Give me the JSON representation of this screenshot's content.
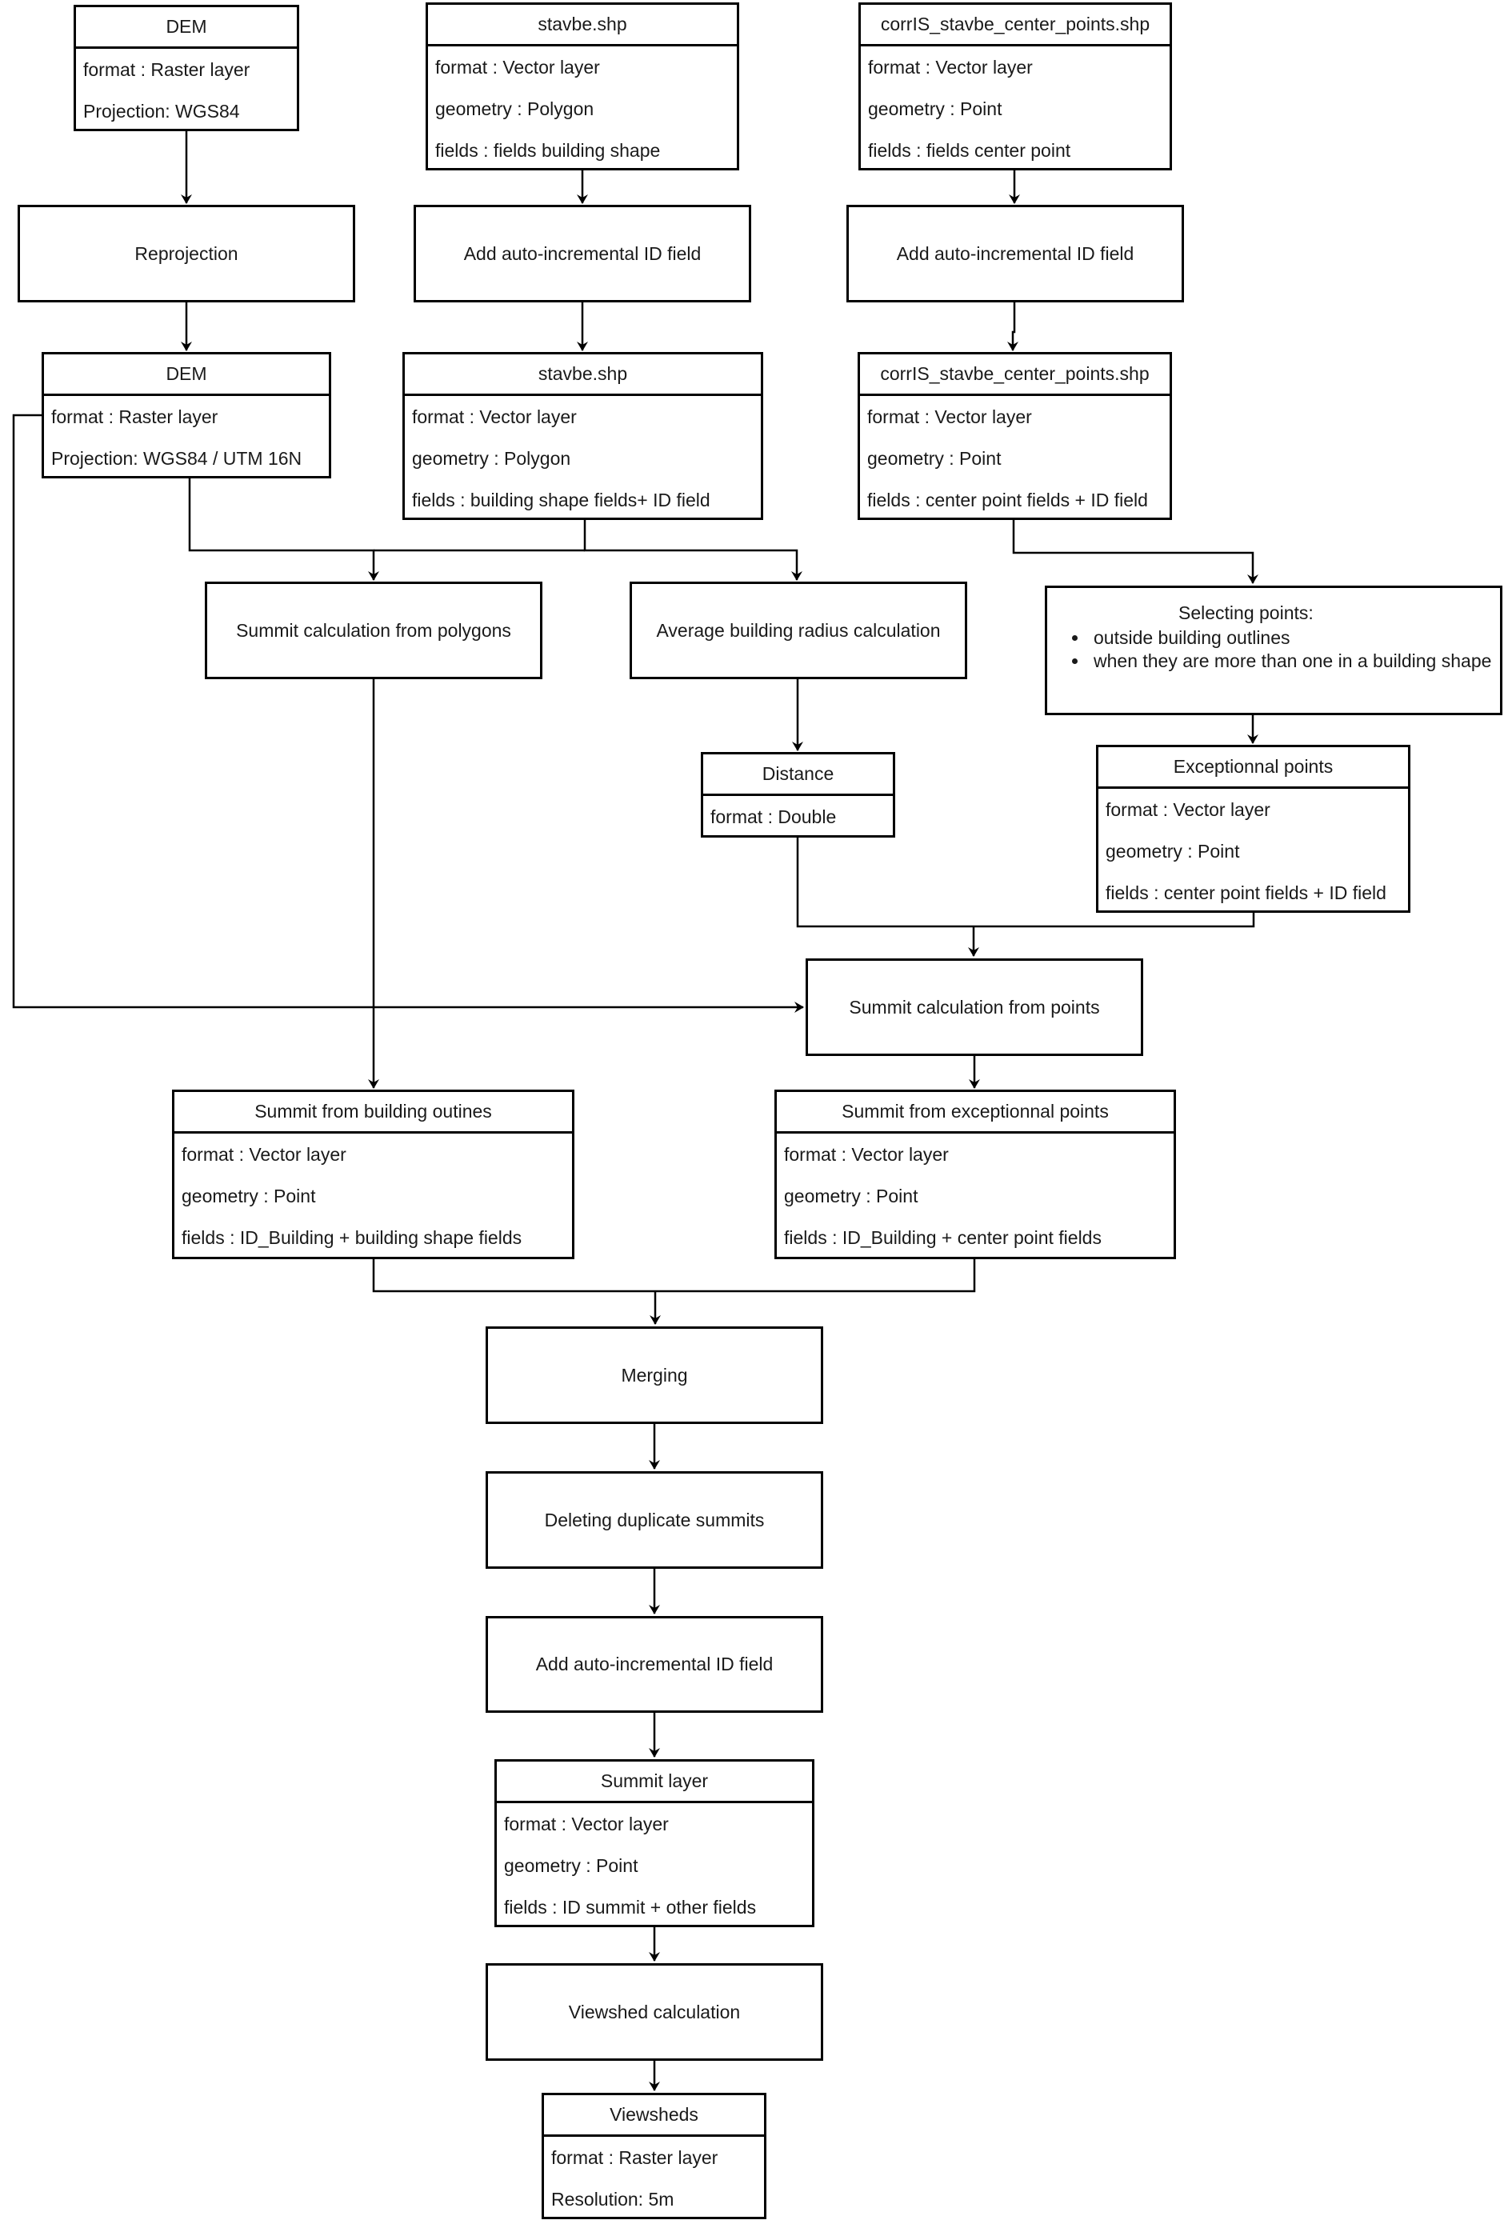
{
  "diagram": {
    "nodes": {
      "dem_input": {
        "title": "DEM",
        "rows": [
          "format : Raster layer",
          "Projection: WGS84"
        ]
      },
      "stavbe_input": {
        "title": "stavbe.shp",
        "rows": [
          "format : Vector layer",
          "geometry : Polygon",
          "fields : fields building shape"
        ]
      },
      "center_points_input": {
        "title": "corrIS_stavbe_center_points.shp",
        "rows": [
          "format : Vector layer",
          "geometry : Point",
          "fields : fields center point"
        ]
      },
      "reprojection": {
        "label": "Reprojection"
      },
      "add_id_stavbe": {
        "label": "Add auto-incremental ID field"
      },
      "add_id_center_points": {
        "label": "Add auto-incremental ID field"
      },
      "dem_reprojected": {
        "title": "DEM",
        "rows": [
          "format : Raster layer",
          "Projection: WGS84 / UTM 16N"
        ]
      },
      "stavbe_with_id": {
        "title": "stavbe.shp",
        "rows": [
          "format : Vector layer",
          "geometry : Polygon",
          "fields : building shape fields+ ID field"
        ]
      },
      "center_points_with_id": {
        "title": "corrIS_stavbe_center_points.shp",
        "rows": [
          "format : Vector layer",
          "geometry : Point",
          "fields : center point fields + ID field"
        ]
      },
      "summit_from_polygons": {
        "label": "Summit calculation from polygons"
      },
      "average_radius": {
        "label": "Average building radius calculation"
      },
      "selecting_points": {
        "title": "Selecting points:",
        "bullets": [
          "outside building outlines",
          "when they are more than one in a building shape"
        ]
      },
      "distance": {
        "title": "Distance",
        "rows": [
          "format : Double"
        ]
      },
      "exceptional_points": {
        "title": "Exceptionnal points",
        "rows": [
          "format : Vector layer",
          "geometry : Point",
          "fields : center point fields + ID field"
        ]
      },
      "summit_from_points": {
        "label": "Summit calculation from points"
      },
      "summit_building_outlines": {
        "title": "Summit from building outines",
        "rows": [
          "format : Vector layer",
          "geometry : Point",
          "fields : ID_Building + building shape fields"
        ]
      },
      "summit_exceptional_points": {
        "title": "Summit from exceptionnal points",
        "rows": [
          "format : Vector layer",
          "geometry : Point",
          "fields : ID_Building + center point fields"
        ]
      },
      "merging": {
        "label": "Merging"
      },
      "deleting_duplicates": {
        "label": "Deleting duplicate summits"
      },
      "add_id_summits": {
        "label": "Add auto-incremental ID field"
      },
      "summit_layer": {
        "title": "Summit layer",
        "rows": [
          "format : Vector layer",
          "geometry : Point",
          "fields : ID summit + other fields"
        ]
      },
      "viewshed_calculation": {
        "label": "Viewshed calculation"
      },
      "viewsheds": {
        "title": "Viewsheds",
        "rows": [
          "format : Raster layer",
          "Resolution: 5m"
        ]
      }
    },
    "colors": {
      "stroke": "#000000",
      "fill": "#ffffff",
      "text": "#1a1a1a"
    }
  }
}
